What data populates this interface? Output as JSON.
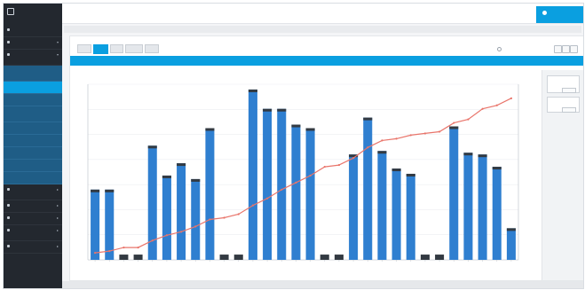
{
  "app": {
    "logo_text": "",
    "logo_sub": ""
  },
  "sidebar": {
    "items": [
      {
        "label": "",
        "caret": "",
        "level": "l1"
      },
      {
        "label": "",
        "caret": "▾",
        "level": "l1"
      },
      {
        "label": "",
        "caret": "▾",
        "level": "l1",
        "tall": true
      },
      {
        "label": "",
        "caret": "",
        "level": "sub",
        "tall": true
      },
      {
        "label": "",
        "caret": "",
        "level": "sub active"
      },
      {
        "label": "",
        "caret": "",
        "level": "sub"
      },
      {
        "label": "",
        "caret": "",
        "level": "sub",
        "tall": true
      },
      {
        "label": "",
        "caret": "",
        "level": "sub"
      },
      {
        "label": "",
        "caret": "",
        "level": "sub"
      },
      {
        "label": "",
        "caret": "",
        "level": "sub"
      },
      {
        "label": "",
        "caret": "",
        "level": "sub"
      },
      {
        "label": "",
        "caret": "",
        "level": "sub"
      },
      {
        "label": "",
        "caret": "▸",
        "level": "l1",
        "tall": true
      },
      {
        "label": "",
        "caret": "▸",
        "level": "l1"
      },
      {
        "label": "",
        "caret": "▸",
        "level": "l1"
      },
      {
        "label": "",
        "caret": "▸",
        "level": "l1",
        "tall": true
      },
      {
        "label": "",
        "caret": "▸",
        "level": "l1"
      }
    ],
    "footer_links": [
      "",
      "",
      "",
      "",
      "",
      ""
    ],
    "bottom_link": ""
  },
  "topbar": {
    "text": "",
    "user_label": ""
  },
  "breadcrumb": {
    "left": "",
    "right": ""
  },
  "tabs": [
    "",
    "",
    "",
    "",
    ""
  ],
  "active_tab": 1,
  "search": {
    "placeholder": ""
  },
  "blue_bar_text": "",
  "right_panel": {
    "box1_label": "",
    "box1_button": "",
    "box2_label": "",
    "box2_button": ""
  },
  "footer_text": "",
  "colors": {
    "accent": "#0a9fe0",
    "sidebar": "#23282f",
    "bar": "#2f7fd0",
    "bar_cap": "#333a42",
    "line": "#e9756b"
  },
  "chart_data": {
    "type": "bar",
    "title": "",
    "xlabel": "",
    "ylabel": "",
    "y2label": "",
    "ylim": [
      0,
      100
    ],
    "y2lim": [
      0,
      100
    ],
    "grid": true,
    "categories": [
      "",
      "",
      "",
      "",
      "",
      "",
      "",
      "",
      "",
      "",
      "",
      "",
      "",
      "",
      "",
      "",
      "",
      "",
      "",
      "",
      "",
      "",
      "",
      "",
      "",
      "",
      "",
      "",
      "",
      ""
    ],
    "series": [
      {
        "kind": "bar",
        "values": [
          40,
          40,
          3,
          3,
          65,
          48,
          55,
          46,
          75,
          3,
          3,
          97,
          86,
          86,
          77,
          75,
          3,
          3,
          60,
          81,
          62,
          52,
          49,
          3,
          3,
          76,
          61,
          60,
          53,
          18
        ]
      },
      {
        "kind": "line",
        "values": [
          4,
          5,
          7,
          7,
          11,
          14,
          16,
          19,
          23,
          24,
          26,
          31,
          35,
          40,
          44,
          48,
          53,
          54,
          58,
          64,
          68,
          69,
          71,
          72,
          73,
          78,
          80,
          86,
          88,
          92
        ]
      }
    ]
  }
}
